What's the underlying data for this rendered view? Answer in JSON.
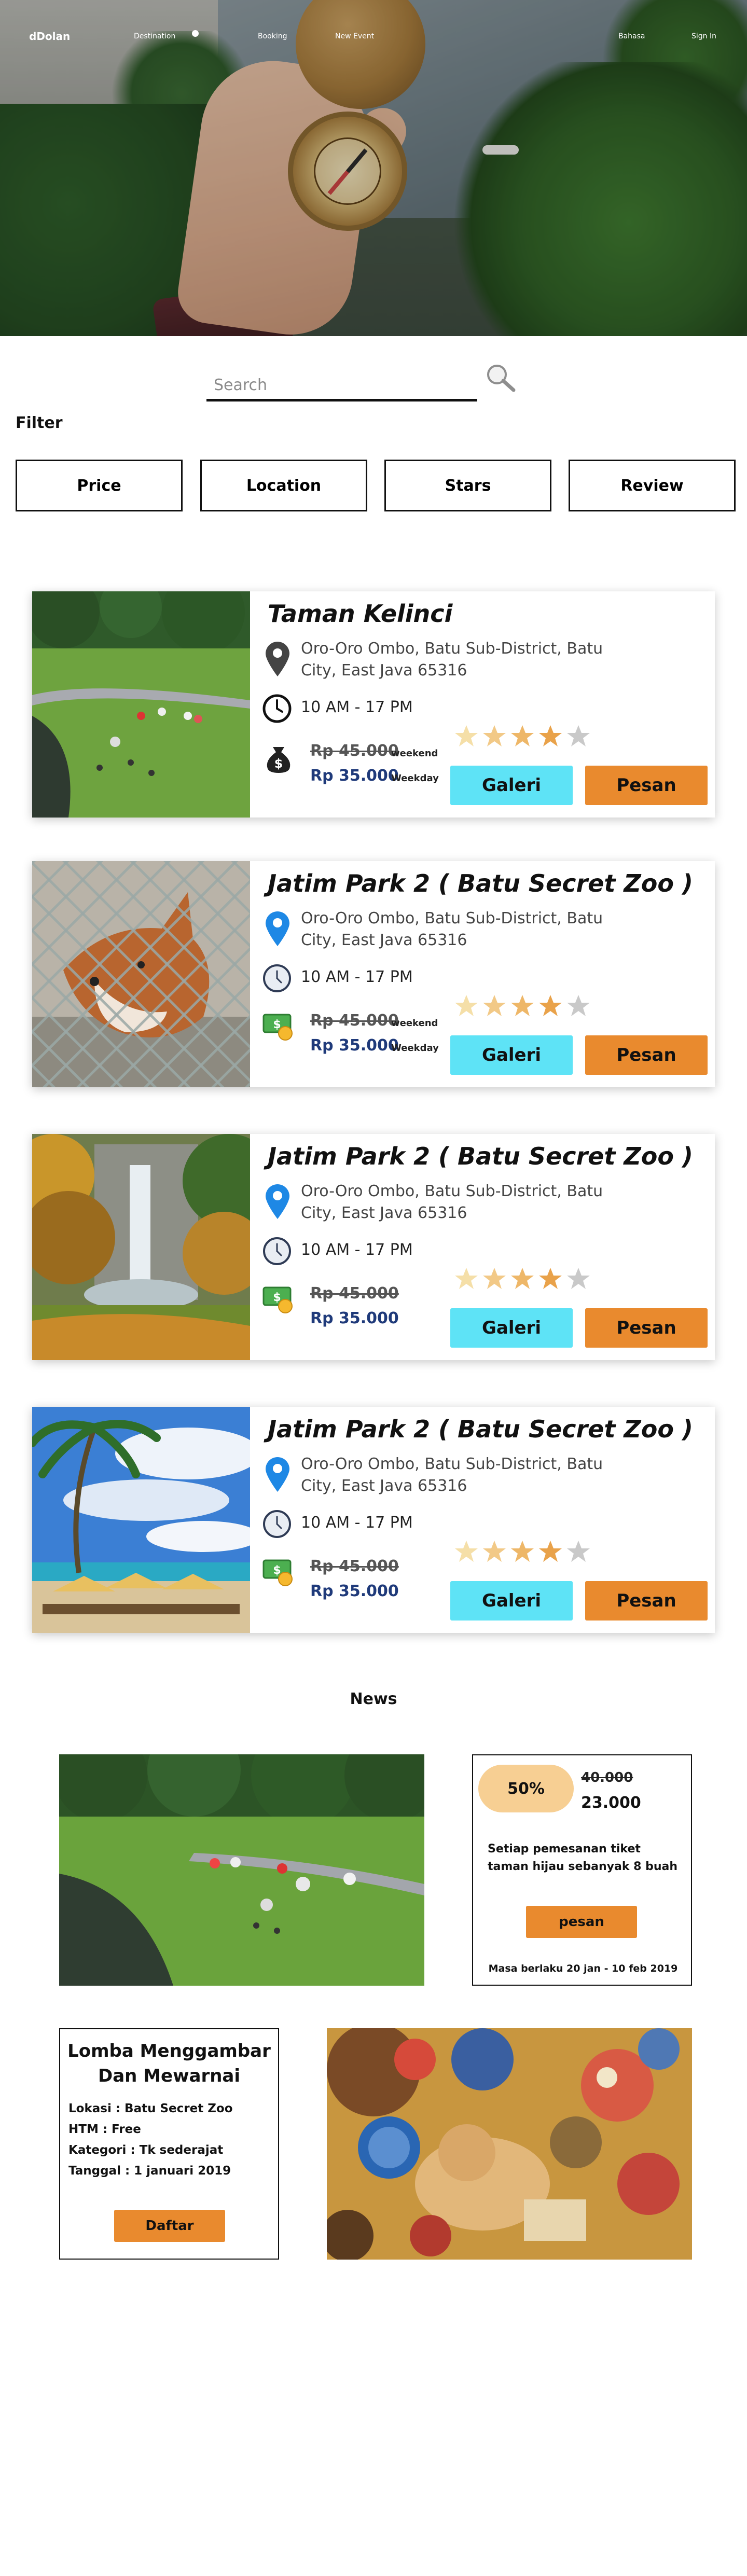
{
  "nav": {
    "logo": "dDolan",
    "links": [
      "Destination",
      "Booking",
      "New Event"
    ],
    "right_links": [
      "Bahasa",
      "Sign In"
    ]
  },
  "search": {
    "placeholder": "Search"
  },
  "filter": {
    "title": "Filter",
    "buttons": [
      "Price",
      "Location",
      "Stars",
      "Review"
    ]
  },
  "cards": [
    {
      "title": "Taman Kelinci",
      "address": "Oro-Oro Ombo, Batu Sub-District, Batu City, East Java 65316",
      "hours": "10 AM - 17 PM",
      "price_old": "Rp 45.000",
      "price_old_label": "weekend",
      "price_new": "Rp 35.000",
      "price_new_label": "Weekday",
      "rating": 4,
      "galeri": "Galeri",
      "pesan": "Pesan"
    },
    {
      "title": "Jatim Park 2 ( Batu Secret Zoo )",
      "address": "Oro-Oro Ombo, Batu Sub-District, Batu City, East Java 65316",
      "hours": "10 AM - 17 PM",
      "price_old": "Rp 45.000",
      "price_old_label": "weekend",
      "price_new": "Rp 35.000",
      "price_new_label": "Weekday",
      "rating": 4,
      "galeri": "Galeri",
      "pesan": "Pesan"
    },
    {
      "title": "Jatim Park 2 ( Batu Secret Zoo )",
      "address": "Oro-Oro Ombo, Batu Sub-District, Batu City, East Java 65316",
      "hours": "10 AM - 17 PM",
      "price_old": "Rp 45.000",
      "price_old_label": "",
      "price_new": "Rp 35.000",
      "price_new_label": "",
      "rating": 4,
      "galeri": "Galeri",
      "pesan": "Pesan"
    },
    {
      "title": "Jatim Park 2 ( Batu Secret Zoo )",
      "address": "Oro-Oro Ombo, Batu Sub-District, Batu City, East Java 65316",
      "hours": "10 AM - 17 PM",
      "price_old": "Rp 45.000",
      "price_old_label": "",
      "price_new": "Rp 35.000",
      "price_new_label": "",
      "rating": 4,
      "galeri": "Galeri",
      "pesan": "Pesan"
    }
  ],
  "news": {
    "title": "News",
    "promo": {
      "discount": "50%",
      "old_price": "40.000",
      "new_price": "23.000",
      "description": "Setiap pemesanan tiket taman hijau sebanyak 8 buah",
      "button": "pesan",
      "validity": "Masa berlaku 20 jan - 10 feb 2019"
    },
    "lomba": {
      "title": "Lomba Menggambar Dan Mewarnai",
      "lokasi": "Lokasi : Batu Secret Zoo",
      "htm": "HTM  : Free",
      "kategori": "Kategori : Tk sederajat",
      "tanggal": "Tanggal : 1 januari 2019",
      "button": "Daftar"
    }
  },
  "colors": {
    "galeri": "#5ee3f6",
    "pesan": "#e98a2e",
    "promo_badge": "#f7cf93",
    "price_new": "#1f3a7a",
    "star_on": "#f0c27a",
    "star_dim": "#c9c9c9"
  },
  "icons": {
    "search": "search-icon",
    "pin": "location-pin-icon",
    "clock": "clock-icon",
    "money": "money-icon",
    "star": "star-icon"
  }
}
